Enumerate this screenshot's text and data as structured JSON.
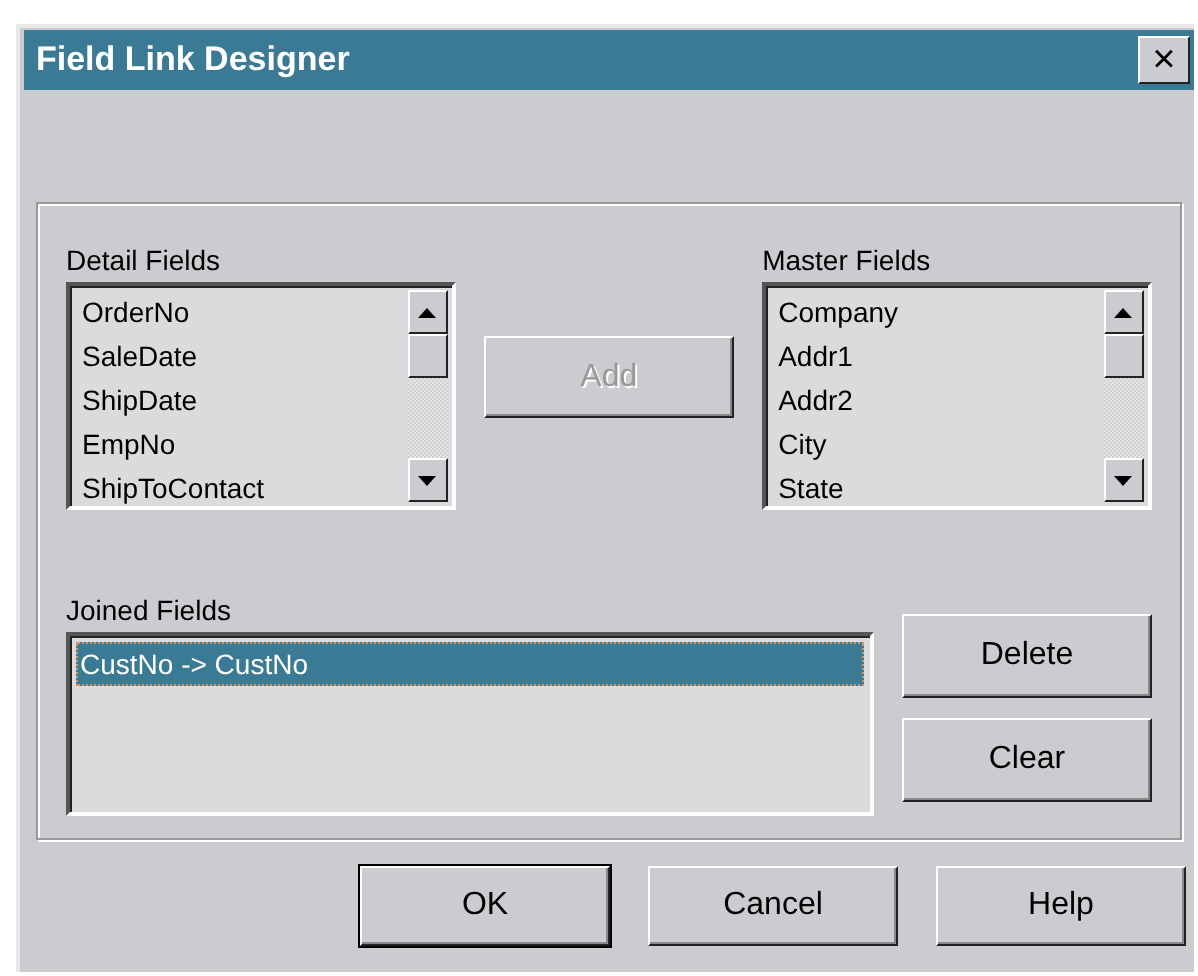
{
  "window": {
    "title": "Field Link Designer",
    "close": "×"
  },
  "detail_fields": {
    "label": "Detail Fields",
    "items": [
      {
        "text": "OrderNo",
        "selected": false
      },
      {
        "text": "SaleDate",
        "selected": false
      },
      {
        "text": "ShipDate",
        "selected": false
      },
      {
        "text": "EmpNo",
        "selected": false
      },
      {
        "text": "ShipToContact",
        "selected": false
      }
    ]
  },
  "add_button": {
    "label": "Add",
    "disabled": true
  },
  "master_fields": {
    "label": "Master Fields",
    "items": [
      {
        "text": "Company",
        "selected": false
      },
      {
        "text": "Addr1",
        "selected": false
      },
      {
        "text": "Addr2",
        "selected": false
      },
      {
        "text": "City",
        "selected": false
      },
      {
        "text": "State",
        "selected": false
      }
    ]
  },
  "joined_fields": {
    "label": "Joined Fields",
    "items": [
      {
        "text": "CustNo -> CustNo",
        "selected": true
      }
    ]
  },
  "side_buttons": [
    {
      "label": "Delete",
      "disabled": false
    },
    {
      "label": "Clear",
      "disabled": false
    }
  ],
  "buttons": [
    {
      "label": "OK",
      "default": true
    },
    {
      "label": "Cancel",
      "default": false
    },
    {
      "label": "Help",
      "default": false
    }
  ]
}
